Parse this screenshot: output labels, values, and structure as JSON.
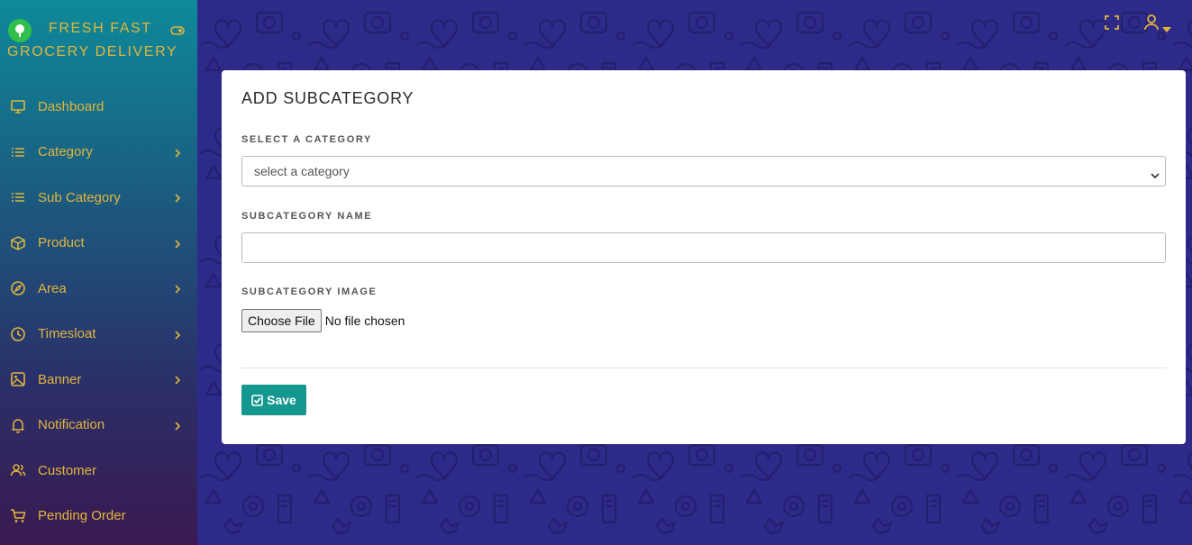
{
  "brand": {
    "line1": "FRESH FAST",
    "line2": "GROCERY DELIVERY",
    "logo_icon": "leaf-logo-icon",
    "toggle_icon": "sidebar-toggle-icon"
  },
  "colors": {
    "sidebar_text": "#e2b63a",
    "accent": "#13978f",
    "page_background": "#2e2a8a",
    "card_background": "#ffffff"
  },
  "sidebar": {
    "items": [
      {
        "label": "Dashboard",
        "icon": "monitor-icon",
        "has_submenu": false
      },
      {
        "label": "Category",
        "icon": "list-icon",
        "has_submenu": true
      },
      {
        "label": "Sub Category",
        "icon": "list-icon",
        "has_submenu": true
      },
      {
        "label": "Product",
        "icon": "package-icon",
        "has_submenu": true
      },
      {
        "label": "Area",
        "icon": "compass-icon",
        "has_submenu": true
      },
      {
        "label": "Timesloat",
        "icon": "clock-icon",
        "has_submenu": true
      },
      {
        "label": "Banner",
        "icon": "image-icon",
        "has_submenu": true
      },
      {
        "label": "Notification",
        "icon": "bell-icon",
        "has_submenu": true
      },
      {
        "label": "Customer",
        "icon": "users-icon",
        "has_submenu": false
      },
      {
        "label": "Pending Order",
        "icon": "cart-icon",
        "has_submenu": false
      }
    ]
  },
  "topbar": {
    "fullscreen_icon": "fullscreen-icon",
    "user_icon": "user-icon"
  },
  "form": {
    "title": "ADD SUBCATEGORY",
    "category_label": "SELECT A CATEGORY",
    "category_selected": "select a category",
    "name_label": "SUBCATEGORY NAME",
    "name_value": "",
    "image_label": "SUBCATEGORY IMAGE",
    "file_button": "Choose File",
    "file_status": "No file chosen",
    "save_label": "Save"
  }
}
